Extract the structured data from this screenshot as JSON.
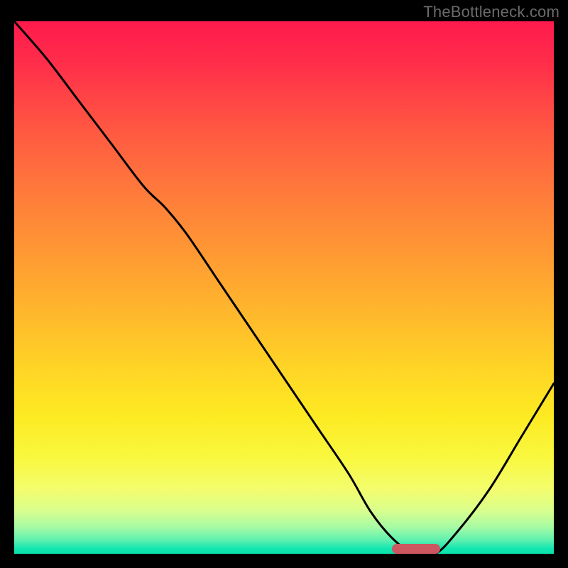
{
  "watermark": "TheBottleneck.com",
  "colors": {
    "frame": "#000000",
    "curve": "#000000",
    "marker": "#cc5760"
  },
  "chart_data": {
    "type": "line",
    "title": "",
    "xlabel": "",
    "ylabel": "",
    "xlim": [
      0,
      100
    ],
    "ylim": [
      0,
      100
    ],
    "grid": false,
    "legend": false,
    "series": [
      {
        "name": "bottleneck-curve",
        "x": [
          0,
          6,
          12,
          18,
          24,
          28,
          32,
          38,
          44,
          50,
          56,
          62,
          66,
          70,
          74,
          78,
          82,
          88,
          94,
          100
        ],
        "values": [
          100,
          93,
          85,
          77,
          69,
          65,
          60,
          51,
          42,
          33,
          24,
          15,
          8,
          3,
          0,
          0,
          4,
          12,
          22,
          32
        ]
      }
    ],
    "annotations": [
      {
        "name": "optimal-marker",
        "x_start": 70,
        "x_end": 79,
        "y": 0
      }
    ]
  }
}
